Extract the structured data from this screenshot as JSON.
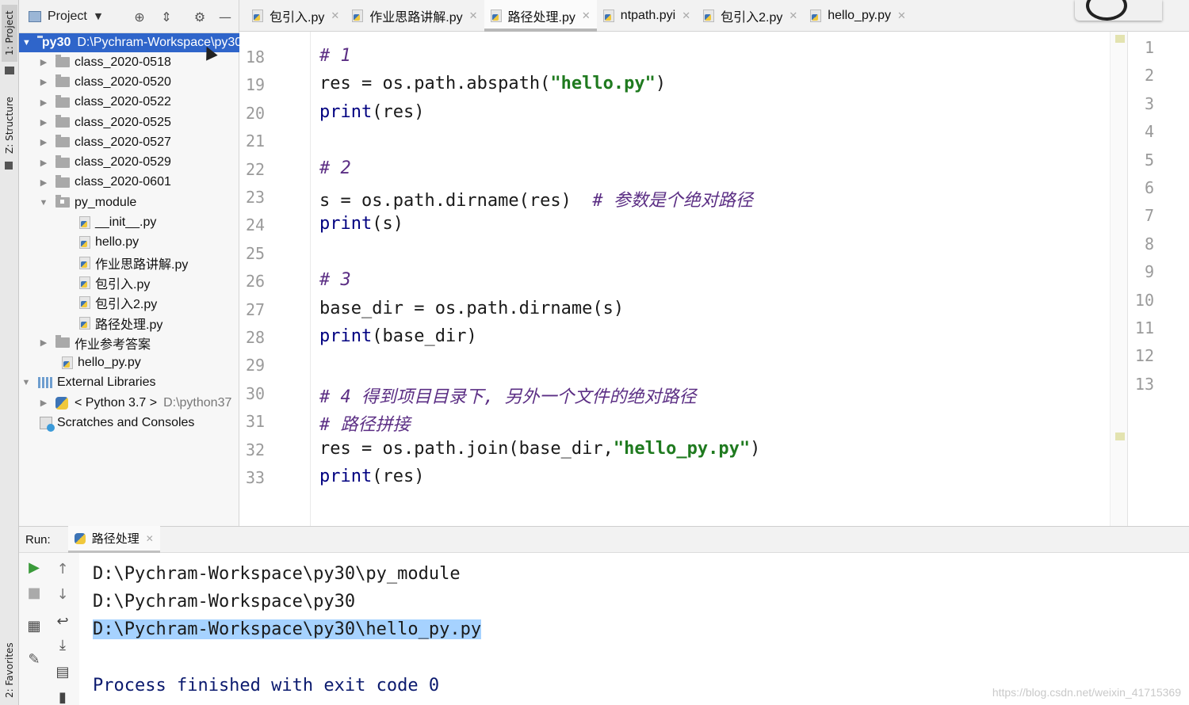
{
  "left_strip": {
    "project_tab": "1: Project",
    "structure_tab": "Z: Structure",
    "favorites_tab": "2: Favorites"
  },
  "project_panel": {
    "title": "Project",
    "tree": [
      {
        "kind": "root",
        "name": "py30",
        "path": "D:\\Pychram-Workspace\\py30"
      },
      {
        "kind": "folder",
        "name": "class_2020-0518"
      },
      {
        "kind": "folder",
        "name": "class_2020-0520"
      },
      {
        "kind": "folder",
        "name": "class_2020-0522"
      },
      {
        "kind": "folder",
        "name": "class_2020-0525"
      },
      {
        "kind": "folder",
        "name": "class_2020-0527"
      },
      {
        "kind": "folder",
        "name": "class_2020-0529"
      },
      {
        "kind": "folder",
        "name": "class_2020-0601"
      },
      {
        "kind": "package",
        "name": "py_module"
      },
      {
        "kind": "file",
        "name": "__init__.py"
      },
      {
        "kind": "file",
        "name": "hello.py"
      },
      {
        "kind": "file",
        "name": "作业思路讲解.py"
      },
      {
        "kind": "file",
        "name": "包引入.py"
      },
      {
        "kind": "file",
        "name": "包引入2.py"
      },
      {
        "kind": "file",
        "name": "路径处理.py"
      },
      {
        "kind": "folder",
        "name": "作业参考答案"
      },
      {
        "kind": "file",
        "name": "hello_py.py"
      },
      {
        "kind": "libraries",
        "name": "External Libraries"
      },
      {
        "kind": "python",
        "name": "< Python 3.7 >",
        "path": "D:\\python37"
      },
      {
        "kind": "scratches",
        "name": "Scratches and Consoles"
      }
    ]
  },
  "tabs": [
    {
      "label": "包引入.py"
    },
    {
      "label": "作业思路讲解.py"
    },
    {
      "label": "路径处理.py",
      "active": true
    },
    {
      "label": "ntpath.pyi"
    },
    {
      "label": "包引入2.py"
    },
    {
      "label": "hello_py.py"
    }
  ],
  "editor": {
    "line_numbers": [
      "18",
      "19",
      "20",
      "21",
      "22",
      "23",
      "24",
      "25",
      "26",
      "27",
      "28",
      "29",
      "30",
      "31",
      "32",
      "33"
    ],
    "lines": [
      {
        "parts": [
          {
            "t": "# 1",
            "c": "cmt"
          }
        ]
      },
      {
        "parts": [
          {
            "t": "res = os.path.abspath(",
            "c": ""
          },
          {
            "t": "\"hello.py\"",
            "c": "str"
          },
          {
            "t": ")",
            "c": ""
          }
        ]
      },
      {
        "parts": [
          {
            "t": "print",
            "c": "fn"
          },
          {
            "t": "(res)",
            "c": ""
          }
        ]
      },
      {
        "parts": []
      },
      {
        "parts": [
          {
            "t": "# 2",
            "c": "cmt"
          }
        ]
      },
      {
        "parts": [
          {
            "t": "s = os.path.dirname(res)  ",
            "c": ""
          },
          {
            "t": "# 参数是个绝对路径",
            "c": "cmt"
          }
        ]
      },
      {
        "parts": [
          {
            "t": "print",
            "c": "fn"
          },
          {
            "t": "(s)",
            "c": ""
          }
        ]
      },
      {
        "parts": []
      },
      {
        "parts": [
          {
            "t": "# 3",
            "c": "cmt"
          }
        ]
      },
      {
        "parts": [
          {
            "t": "base_dir = os.path.dirname(s)",
            "c": ""
          }
        ]
      },
      {
        "parts": [
          {
            "t": "print",
            "c": "fn"
          },
          {
            "t": "(base_dir)",
            "c": ""
          }
        ]
      },
      {
        "parts": []
      },
      {
        "parts": [
          {
            "t": "# 4 得到项目目录下, 另外一个文件的绝对路径",
            "c": "cmt"
          }
        ]
      },
      {
        "parts": [
          {
            "t": "# 路径拼接",
            "c": "cmt"
          }
        ]
      },
      {
        "parts": [
          {
            "t": "res = os.path.join(base_dir,",
            "c": ""
          },
          {
            "t": "\"hello_py.py\"",
            "c": "str"
          },
          {
            "t": ")",
            "c": ""
          }
        ]
      },
      {
        "parts": [
          {
            "t": "print",
            "c": "fn"
          },
          {
            "t": "(res)",
            "c": ""
          }
        ]
      }
    ]
  },
  "mini_editor": {
    "line_numbers": [
      "1",
      "2",
      "3",
      "4",
      "5",
      "6",
      "7",
      "8",
      "9",
      "10",
      "11",
      "12",
      "13"
    ]
  },
  "run_panel": {
    "label": "Run:",
    "tab_label": "路径处理",
    "output": [
      "D:\\Pychram-Workspace\\py30\\py_module",
      "D:\\Pychram-Workspace\\py30",
      "D:\\Pychram-Workspace\\py30\\hello_py.py",
      "",
      "Process finished with exit code 0"
    ]
  },
  "watermark": "https://blog.csdn.net/weixin_41715369",
  "colors": {
    "selection": "#2f65ca",
    "output_selection": "#a6d2ff",
    "comment": "#5b2e84",
    "string": "#1f7a1f"
  }
}
